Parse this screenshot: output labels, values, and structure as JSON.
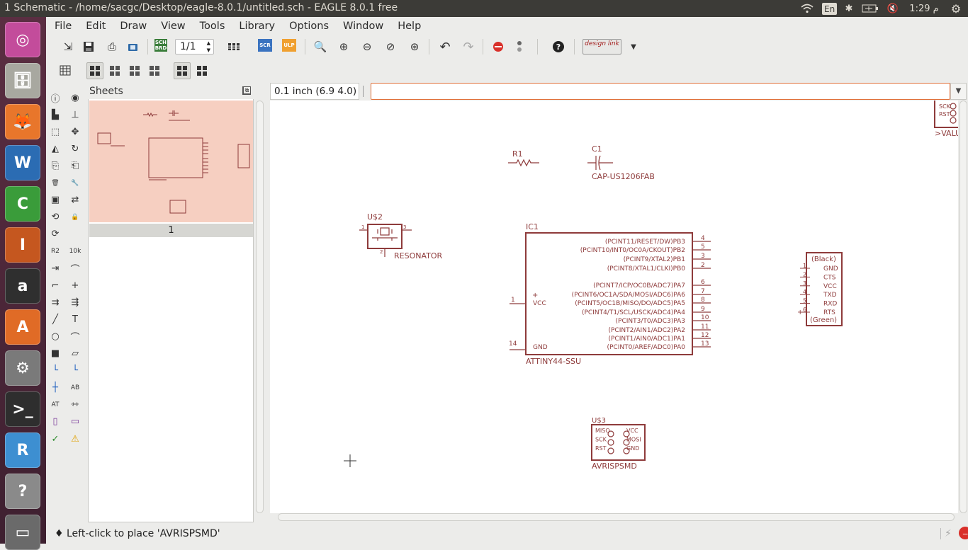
{
  "topbar": {
    "window_title": "1 Schematic - /home/sacgc/Desktop/eagle-8.0.1/untitled.sch - EAGLE 8.0.1 free",
    "keyboard_layout": "En",
    "clock": "1:29 م"
  },
  "launcher": [
    {
      "name": "ubuntu-dash-icon",
      "glyph": "◎",
      "color": "#c34c9b"
    },
    {
      "name": "files-icon",
      "glyph": "🗄",
      "color": "#a8a8a0"
    },
    {
      "name": "firefox-icon",
      "glyph": "🦊",
      "color": "#e8762b"
    },
    {
      "name": "writer-icon",
      "glyph": "W",
      "color": "#2b6cb3"
    },
    {
      "name": "calc-icon",
      "glyph": "C",
      "color": "#3a9c3a"
    },
    {
      "name": "impress-icon",
      "glyph": "I",
      "color": "#c5571f"
    },
    {
      "name": "amazon-icon",
      "glyph": "a",
      "color": "#2f2f2f"
    },
    {
      "name": "software-center-icon",
      "glyph": "A",
      "color": "#e06b26"
    },
    {
      "name": "system-settings-icon",
      "glyph": "⚙",
      "color": "#7a7a7a"
    },
    {
      "name": "terminal-icon",
      "glyph": ">_",
      "color": "#2e2e2e"
    },
    {
      "name": "rstudio-icon",
      "glyph": "R",
      "color": "#3d8fd1"
    },
    {
      "name": "help-icon",
      "glyph": "?",
      "color": "#8a8a8a"
    },
    {
      "name": "disk-icon",
      "glyph": "▭",
      "color": "#6a6a6a"
    }
  ],
  "menu": [
    "File",
    "Edit",
    "Draw",
    "View",
    "Tools",
    "Library",
    "Options",
    "Window",
    "Help"
  ],
  "toolbar": {
    "sheet_selector": "1/1",
    "scr_label": "SCR",
    "ulp_label": "ULP",
    "sch_brd_label": "SCH BRD",
    "design_link_label": "design link"
  },
  "sheets_panel": {
    "title": "Sheets",
    "sheet_number": "1"
  },
  "coord_display": "0.1 inch (6.9 4.0)",
  "command_input": "",
  "status": "♦  Left-click to place 'AVRISPSMD'",
  "schematic": {
    "r1": {
      "name": "R1"
    },
    "c1": {
      "name": "C1",
      "value": "CAP-US1206FAB"
    },
    "resonator": {
      "name": "U$2",
      "value": "RESONATOR",
      "pin1": "1",
      "pin2": "2",
      "pin3": "3"
    },
    "ic1": {
      "name": "IC1",
      "value": "ATTINY44-SSU",
      "vcc": "VCC",
      "gnd": "GND",
      "vcc_pin": "1",
      "gnd_pin": "14",
      "plus": "+",
      "pins": [
        {
          "label": "(PCINT11/RESET/DW)PB3",
          "num": "4"
        },
        {
          "label": "(PCINT10/INT0/OC0A/CKOUT)PB2",
          "num": "5"
        },
        {
          "label": "(PCINT9/XTAL2)PB1",
          "num": "3"
        },
        {
          "label": "(PCINT8/XTAL1/CLKI)PB0",
          "num": "2"
        },
        {
          "label": "(PCINT7/ICP/OC0B/ADC7)PA7",
          "num": "6"
        },
        {
          "label": "(PCINT6/OC1A/SDA/MOSI/ADC6)PA6",
          "num": "7"
        },
        {
          "label": "(PCINT5/OC1B/MISO/DO/ADC5)PA5",
          "num": "8"
        },
        {
          "label": "(PCINT4/T1/SCL/USCK/ADC4)PA4",
          "num": "9"
        },
        {
          "label": "(PCINT3/T0/ADC3)PA3",
          "num": "10"
        },
        {
          "label": "(PCINT2/AIN1/ADC2)PA2",
          "num": "11"
        },
        {
          "label": "(PCINT1/AIN0/ADC1)PA1",
          "num": "12"
        },
        {
          "label": "(PCINT0/AREF/ADC0)PA0",
          "num": "13"
        }
      ]
    },
    "ftdi": {
      "top": "(Black)",
      "bottom": "(Green)",
      "pins": [
        {
          "n": "1",
          "l": "GND"
        },
        {
          "n": "2",
          "l": "CTS"
        },
        {
          "n": "3",
          "l": "VCC"
        },
        {
          "n": "4",
          "l": "TXD"
        },
        {
          "n": "5",
          "l": "RXD"
        },
        {
          "n": "6",
          "l": "RTS"
        }
      ]
    },
    "avr": {
      "name": "U$3",
      "value": "AVRISPSMD",
      "left": [
        "MISO",
        "SCK",
        "RST"
      ],
      "right": [
        "VCC",
        "MOSI",
        "GND"
      ]
    },
    "partial": {
      "l1": "SCK",
      "l2": "RST",
      "value": ">VALU"
    }
  }
}
